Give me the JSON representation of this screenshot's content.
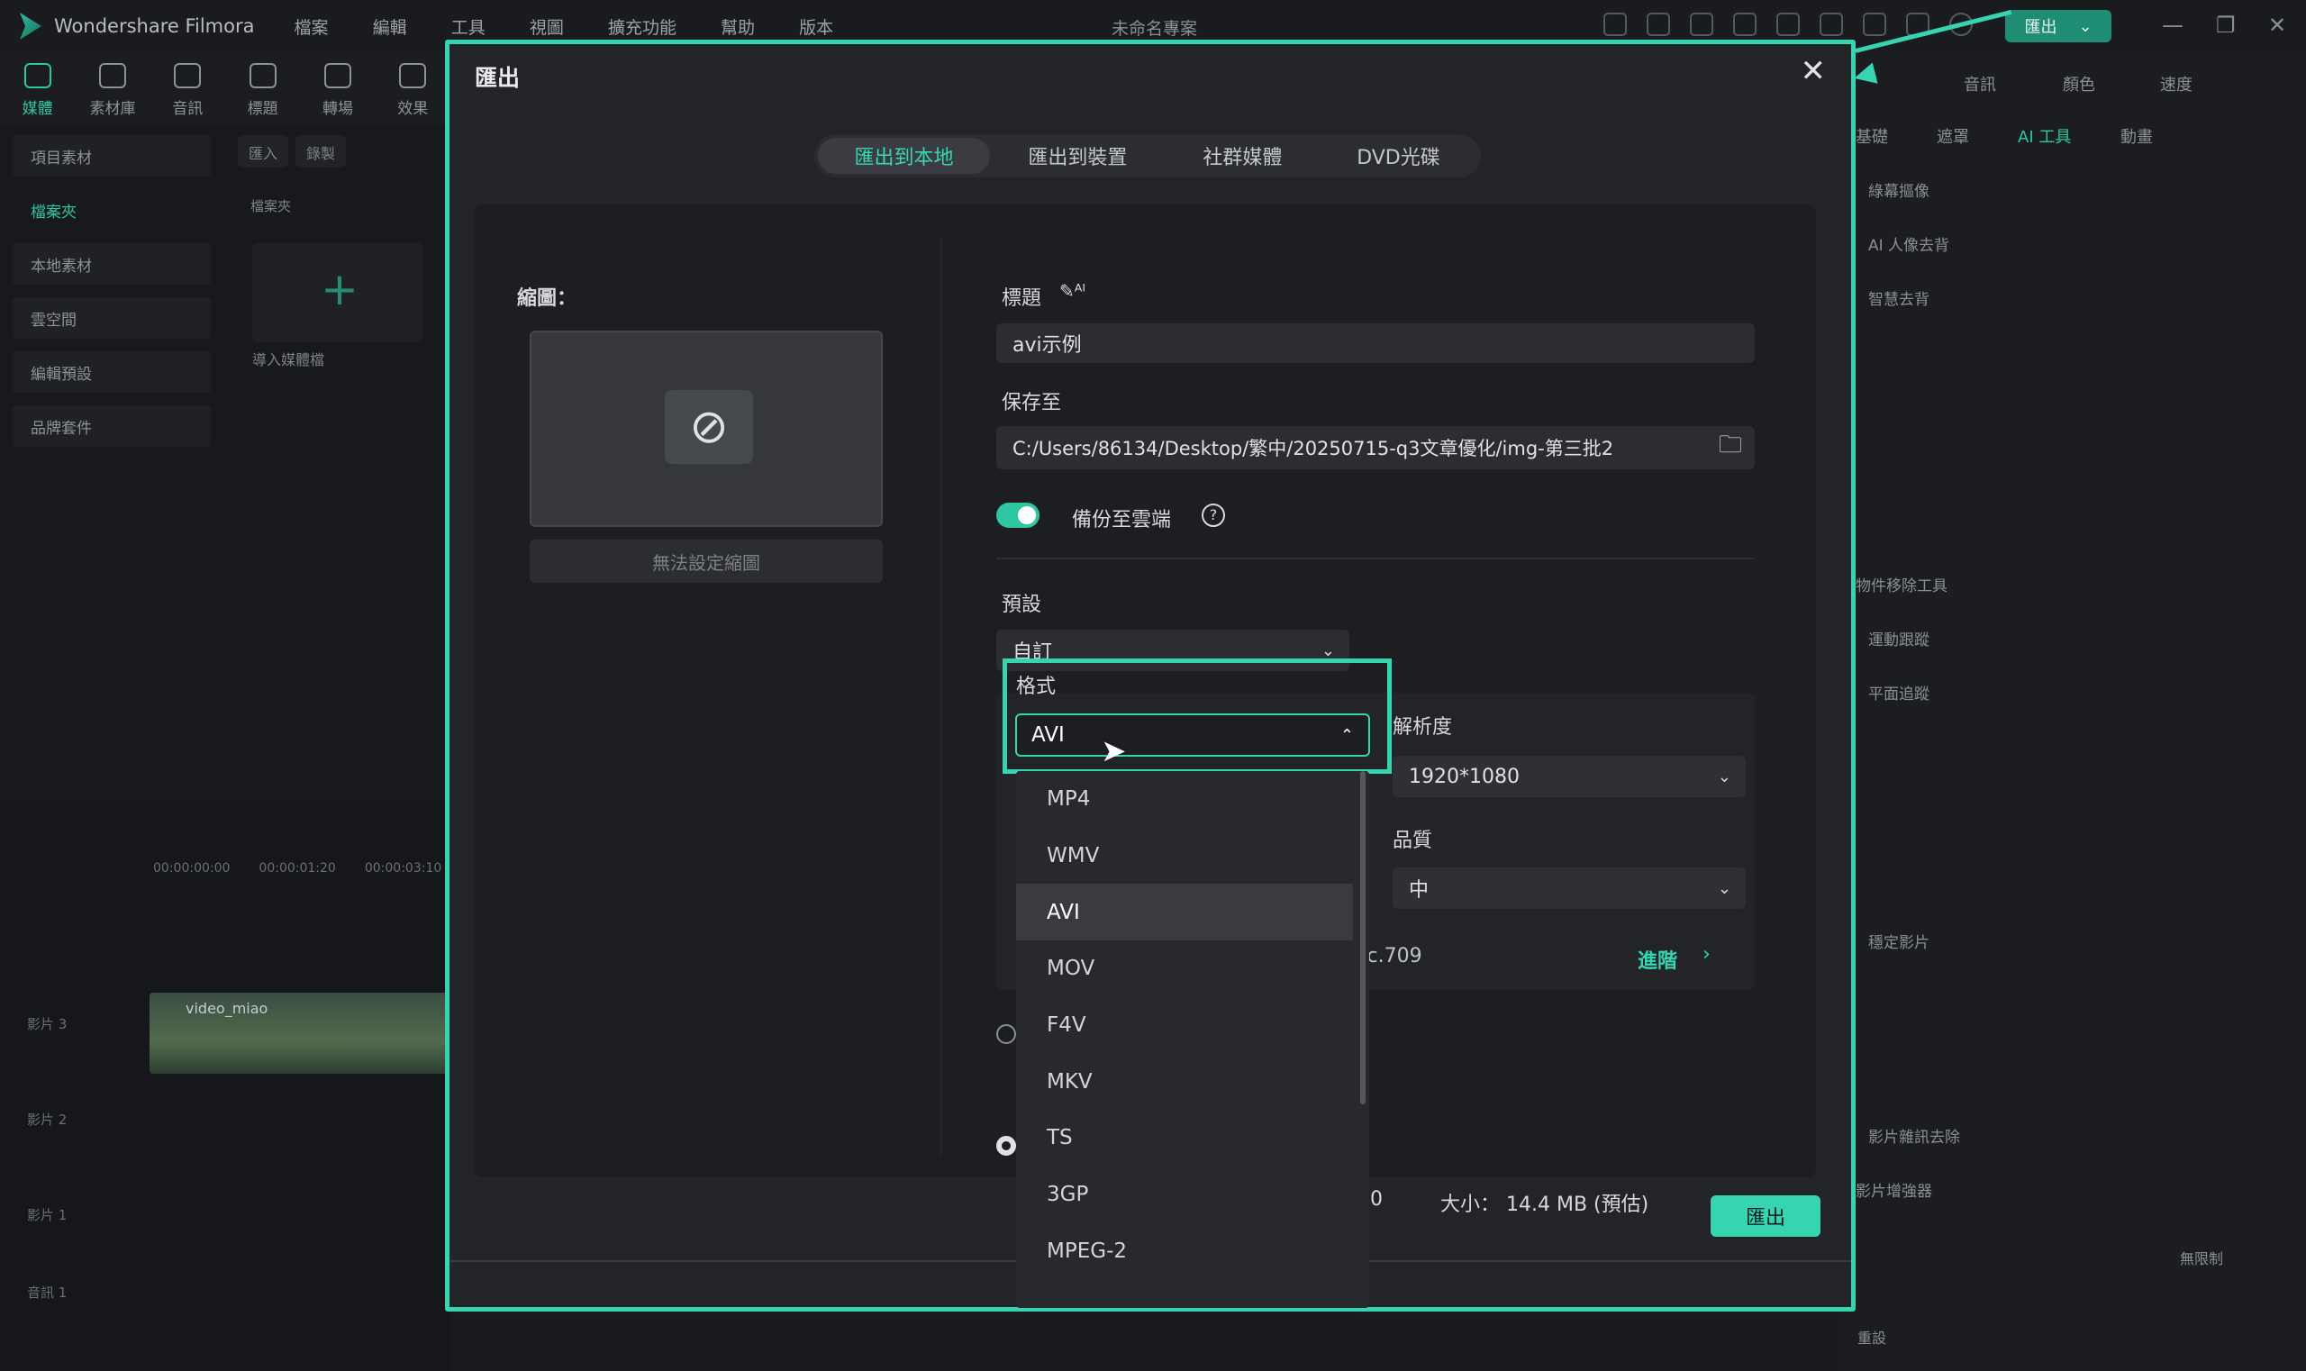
{
  "app": {
    "name": "Wondershare Filmora",
    "project_title": "未命名專案",
    "export_label": "匯出"
  },
  "menu": [
    "檔案",
    "編輯",
    "工具",
    "視圖",
    "擴充功能",
    "幫助",
    "版本"
  ],
  "toolbar": [
    "媒體",
    "素材庫",
    "音訊",
    "標題",
    "轉場",
    "效果"
  ],
  "left_nav": [
    "項目素材",
    "檔案夾",
    "本地素材",
    "雲空間",
    "編輯預設",
    "品牌套件"
  ],
  "media": {
    "import_chip": "匯入",
    "record_chip": "錄製",
    "folder_label": "檔案夾",
    "import_label": "導入媒體檔"
  },
  "timeline": {
    "tracks": [
      "影片 3",
      "影片 2",
      "影片 1",
      "音訊 1"
    ],
    "clip_name": "video_miao",
    "times": [
      "00:00:00:00",
      "00:00:01:20",
      "00:00:03:10"
    ]
  },
  "right_panel": {
    "tabs": [
      "音訊",
      "顏色",
      "速度"
    ],
    "subtabs": [
      "基礎",
      "遮罩",
      "AI 工具",
      "動畫"
    ],
    "items": [
      "綠幕摳像",
      "AI 人像去背",
      "智慧去背",
      "物件移除工具",
      "運動跟蹤",
      "平面追蹤",
      "穩定影片",
      "影片雜訊去除",
      "影片增強器"
    ],
    "unlimited": "無限制",
    "reset": "重設"
  },
  "dialog": {
    "title": "匯出",
    "tabs": [
      "匯出到本地",
      "匯出到裝置",
      "社群媒體",
      "DVD光碟"
    ],
    "thumbnail_label": "縮圖：",
    "thumbnail_button": "無法設定縮圖",
    "title_label": "標題",
    "title_value": "avi示例",
    "save_label": "保存至",
    "save_path": "C:/Users/86134/Desktop/繁中/20250715-q3文章優化/img-第三批2",
    "backup_label": "備份至雲端",
    "preset_label": "預設",
    "preset_value": "自訂",
    "format_label": "格式",
    "format_value": "AVI",
    "resolution_label": "解析度",
    "resolution_value": "1920*1080",
    "quality_label": "品質",
    "quality_value": "中",
    "color_partial": "ec.709",
    "advanced_label": "進階",
    "size_text": "大小： 14.4 MB (預估)",
    "duration_partial": "0",
    "export_button": "匯出",
    "format_options": [
      "MP4",
      "WMV",
      "AVI",
      "MOV",
      "F4V",
      "MKV",
      "TS",
      "3GP",
      "MPEG-2"
    ]
  },
  "accent_color": "#37d4b2"
}
